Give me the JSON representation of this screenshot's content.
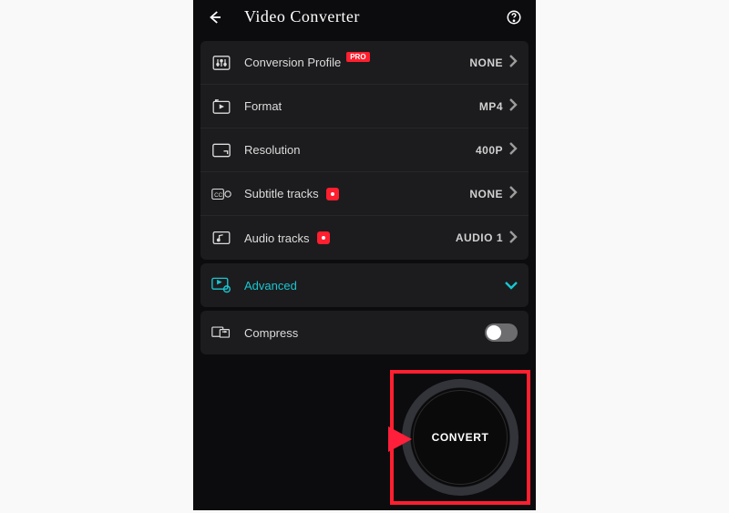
{
  "header": {
    "title": "Video Converter"
  },
  "settings": {
    "profile": {
      "label": "Conversion Profile",
      "badge": "PRO",
      "value": "NONE"
    },
    "format": {
      "label": "Format",
      "value": "MP4"
    },
    "resolution": {
      "label": "Resolution",
      "value": "400P"
    },
    "subtitle": {
      "label": "Subtitle tracks",
      "value": "NONE"
    },
    "audio": {
      "label": "Audio tracks",
      "value": "AUDIO 1"
    }
  },
  "advanced": {
    "label": "Advanced"
  },
  "compress": {
    "label": "Compress",
    "enabled": false
  },
  "action": {
    "convert": "CONVERT"
  }
}
